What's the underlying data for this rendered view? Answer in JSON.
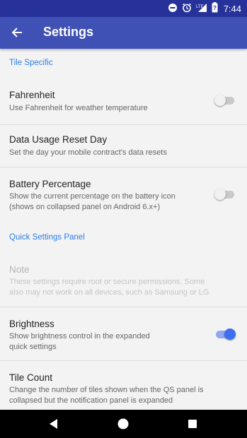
{
  "status_bar": {
    "time": "7:44",
    "network": "LTE",
    "battery_level": "?"
  },
  "app_bar": {
    "title": "Settings"
  },
  "sections": {
    "tile_specific": "Tile Specific",
    "quick_settings_panel": "Quick Settings Panel"
  },
  "prefs": {
    "fahrenheit": {
      "title": "Fahrenheit",
      "summary": "Use Fahrenheit for weather temperature",
      "enabled": false
    },
    "data_usage": {
      "title": "Data Usage Reset Day",
      "summary": "Set the day your mobile contract's data resets"
    },
    "battery": {
      "title": "Battery Percentage",
      "summary_line1": "Show the current percentage on the battery icon",
      "summary_line2": "(shows on collapsed panel on Android 6.x+)",
      "enabled": false
    },
    "note": {
      "title": "Note",
      "summary_line1": "These settings require root or secure permissions. Some",
      "summary_line2": "also may not work on all devices, such as Samsung or LG"
    },
    "brightness": {
      "title": "Brightness",
      "summary_line1": "Show brightness control in the expanded",
      "summary_line2": "quick settings",
      "enabled": true
    },
    "tile_count": {
      "title": "Tile Count",
      "summary_line1": "Change the number of tiles shown when the QS panel is",
      "summary_line2": "collapsed but the notification panel is expanded"
    }
  },
  "colors": {
    "primary": "#3f51b5",
    "status_bar": "#26329a",
    "accent": "#2b7de9",
    "switch_on": "#3d6ef0"
  },
  "icons": {
    "status": [
      "dnd-icon",
      "alarm-icon",
      "lte-signal-icon",
      "battery-icon"
    ],
    "nav": [
      "back-triangle-icon",
      "home-circle-icon",
      "recents-square-icon"
    ]
  }
}
